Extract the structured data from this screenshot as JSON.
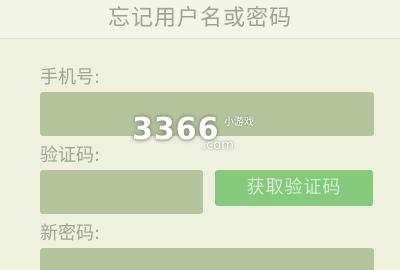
{
  "header": {
    "title": "忘记用户名或密码"
  },
  "form": {
    "phone_label": "手机号:",
    "phone_value": "",
    "code_label": "验证码:",
    "code_value": "",
    "get_code_button": "获取验证码",
    "new_password_label": "新密码:",
    "new_password_value": ""
  },
  "watermark": {
    "digits": "3366",
    "suffix": "小游戏",
    "domain": ".com"
  },
  "colors": {
    "background": "#eef1de",
    "input_fill": "#b6c49e",
    "button_fill": "#84c97c",
    "label_text": "#9fa590"
  }
}
